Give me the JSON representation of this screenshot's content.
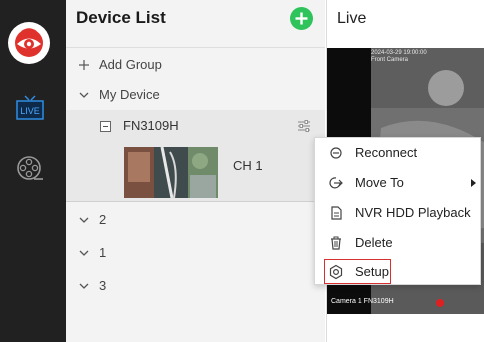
{
  "sidebar": {
    "items": [
      {
        "name": "app-logo",
        "icon": "eye-logo-icon"
      },
      {
        "name": "live",
        "icon": "live-tv-icon",
        "label": "LIVE",
        "active": true
      },
      {
        "name": "playback",
        "icon": "film-reel-icon"
      }
    ],
    "accent": "#2f8de4"
  },
  "device_list": {
    "title": "Device List",
    "add_icon": "plus-icon",
    "add_group_label": "Add Group",
    "my_device_label": "My Device",
    "device": {
      "name": "FN3109H",
      "channel_label": "CH 1"
    },
    "groups": [
      "2",
      "1",
      "3"
    ]
  },
  "live": {
    "title": "Live",
    "osd_timestamp": "2024-03-29 19:00:00",
    "osd_name": "Front Camera",
    "osd_bottom": "Camera  1  FN3109H"
  },
  "context_menu": {
    "items": [
      {
        "label": "Reconnect",
        "icon": "reconnect-icon"
      },
      {
        "label": "Move To",
        "icon": "move-arrow-icon",
        "has_submenu": true
      },
      {
        "label": "NVR HDD Playback",
        "icon": "document-icon"
      },
      {
        "label": "Delete",
        "icon": "trash-icon"
      },
      {
        "label": "Setup",
        "icon": "gear-icon",
        "highlighted": true
      }
    ]
  },
  "colors": {
    "add_button": "#2fc35c",
    "highlight_border": "#d83030",
    "rail_bg": "#212121"
  }
}
